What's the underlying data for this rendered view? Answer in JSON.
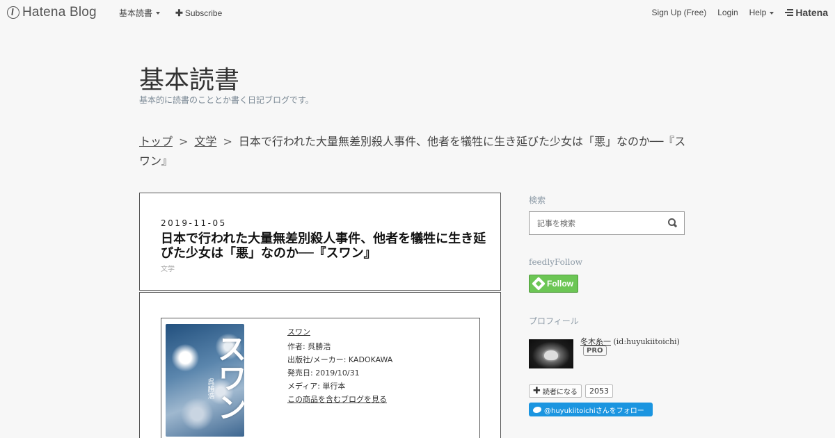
{
  "topbar": {
    "logo_text": "Hatena Blog",
    "nav_left": [
      {
        "label": "基本読書",
        "has_caret": true
      },
      {
        "label": "Subscribe",
        "has_plus": true
      }
    ],
    "signup": "Sign Up (Free)",
    "login": "Login",
    "help": "Help",
    "brand": "Hatena"
  },
  "blog": {
    "title": "基本読書",
    "description": "基本的に読書のこととか書く日記ブログです。"
  },
  "breadcrumb": {
    "top": "トップ",
    "category": "文学",
    "separator": ">",
    "current": "日本で行われた大量無差別殺人事件、他者を犠牲に生き延びた少女は「悪」なのか──『スワン』"
  },
  "entry": {
    "date": "2019-11-05",
    "title": "日本で行われた大量無差別殺人事件、他者を犠牲に生き延びた少女は「悪」なのか──『スワン』",
    "category": "文学",
    "product": {
      "cover_title": "スワン",
      "cover_author": "呉勝浩",
      "name": "スワン",
      "author": "作者: 呉勝浩",
      "publisher": "出版社/メーカー: KADOKAWA",
      "release": "発売日: 2019/10/31",
      "media": "メディア: 単行本",
      "blog_link": "この商品を含むブログを見る"
    }
  },
  "sidebar": {
    "search_heading": "検索",
    "search_placeholder": "記事を検索",
    "feedly_heading": "feedlyFollow",
    "feedly_button": "Follow",
    "profile_heading": "プロフィール",
    "profile_name": "冬木糸一",
    "profile_id": "(id:huyukiitoichi)",
    "pro_badge": "PRO",
    "reader_button": "読者になる",
    "reader_count": "2053",
    "twitter_button": "@huyukiitoichiさんをフォロー"
  },
  "colors": {
    "background": "#f7f7f7",
    "feedly_green": "#6cc655",
    "twitter_blue": "#1b95e0",
    "sidebar_heading": "#8c9aa6"
  }
}
